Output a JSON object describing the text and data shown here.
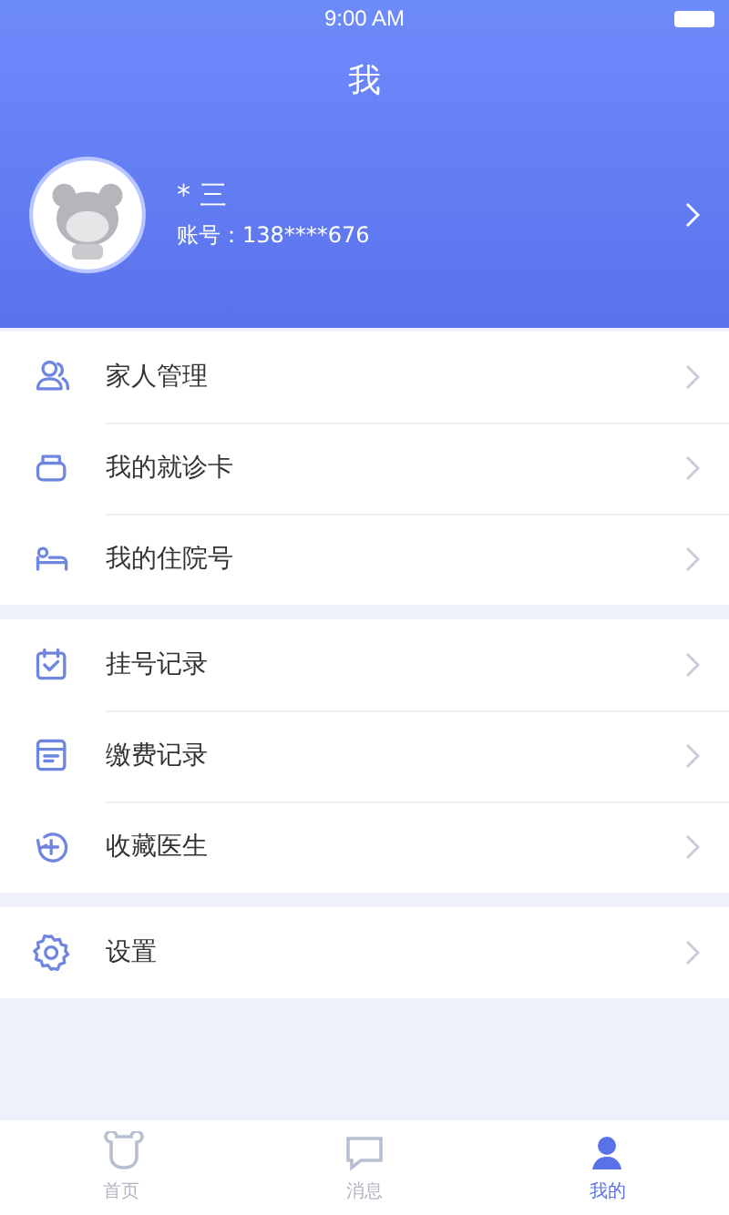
{
  "status_bar": {
    "time": "9:00 AM"
  },
  "header": {
    "title": "我",
    "name": "* 三",
    "account": "账号：138****676"
  },
  "groups": [
    {
      "items": [
        {
          "label": "家人管理"
        },
        {
          "label": "我的就诊卡"
        },
        {
          "label": "我的住院号"
        }
      ]
    },
    {
      "items": [
        {
          "label": "挂号记录"
        },
        {
          "label": "缴费记录"
        },
        {
          "label": "收藏医生"
        }
      ]
    },
    {
      "items": [
        {
          "label": "设置"
        }
      ]
    }
  ],
  "tabs": [
    {
      "label": "首页",
      "selected": false
    },
    {
      "label": "消息",
      "selected": false
    },
    {
      "label": "我的",
      "selected": true
    }
  ]
}
